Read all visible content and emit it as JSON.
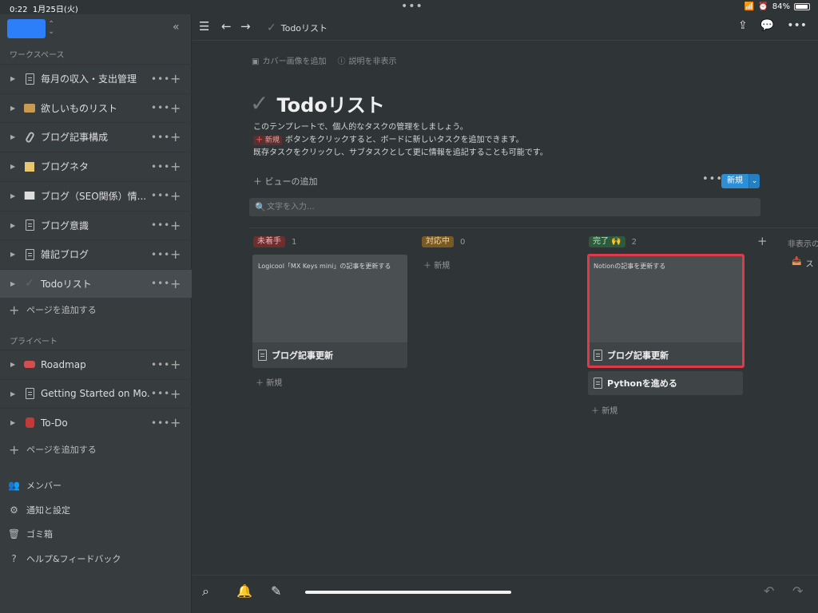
{
  "status": {
    "time": "0:22",
    "date": "1月25日(火)",
    "battery": "84%",
    "battery_level": 0.84
  },
  "sidebar": {
    "workspace_label": "ワークスペース",
    "workspace_items": [
      {
        "label": "毎月の収入・支出管理",
        "icon": "page-icon"
      },
      {
        "label": "欲しいものリスト",
        "icon": "folder-icon"
      },
      {
        "label": "ブログ記事構成",
        "icon": "paperclip-icon"
      },
      {
        "label": "ブログネタ",
        "icon": "note-icon"
      },
      {
        "label": "ブログ（SEO関係）情...",
        "icon": "book-icon"
      },
      {
        "label": "ブログ意識",
        "icon": "page-icon"
      },
      {
        "label": "雑記ブログ",
        "icon": "page-icon"
      },
      {
        "label": "Todoリスト",
        "icon": "check-icon",
        "active": true
      }
    ],
    "add_page": "ページを追加する",
    "private_label": "プライベート",
    "private_items": [
      {
        "label": "Roadmap",
        "icon": "car-icon"
      },
      {
        "label": "Getting Started on Mo...",
        "icon": "page-icon"
      },
      {
        "label": "To-Do",
        "icon": "bag-icon"
      }
    ],
    "add_page_private": "ページを追加する",
    "footer": [
      {
        "label": "メンバー",
        "icon": "members-icon"
      },
      {
        "label": "通知と設定",
        "icon": "settings-icon"
      },
      {
        "label": "ゴミ箱",
        "icon": "trash-icon"
      },
      {
        "label": "ヘルプ&フィードバック",
        "icon": "help-icon"
      }
    ]
  },
  "topbar": {
    "breadcrumb": "Todoリスト"
  },
  "page": {
    "add_cover": "カバー画像を追加",
    "hide_description": "説明を非表示",
    "title": "Todoリスト",
    "desc_line1": "このテンプレートで、個人的なタスクの管理をしましょう。",
    "desc_chip": "新規",
    "desc_line2": "ボタンをクリックすると、ボードに新しいタスクを追加できます。",
    "desc_line3": "既存タスクをクリックし、サブタスクとして更に情報を追記することも可能です。",
    "add_view": "ビューの追加",
    "new_button": "新規",
    "search_placeholder": "文字を入力..."
  },
  "board": {
    "columns": [
      {
        "tag": "未着手",
        "count": "1",
        "tag_bg": "#6e2e2e",
        "tag_fg": "#f0b5b5"
      },
      {
        "tag": "対応中",
        "count": "0",
        "tag_bg": "#7a5a24",
        "tag_fg": "#f2d9a6"
      },
      {
        "tag": "完了 🙌",
        "count": "2",
        "tag_bg": "#2d5a3a",
        "tag_fg": "#b8e6c4"
      }
    ],
    "cards": [
      {
        "cover_text": "Logicool「MX Keys mini」の記事を更新する",
        "title": "ブログ記事更新"
      },
      {
        "cover_text": "Notionの記事を更新する",
        "title": "ブログ記事更新"
      },
      {
        "title": "Pythonを進める"
      }
    ],
    "add_new": "新規",
    "hidden_label": "非表示の",
    "hidden_item": "ス"
  }
}
